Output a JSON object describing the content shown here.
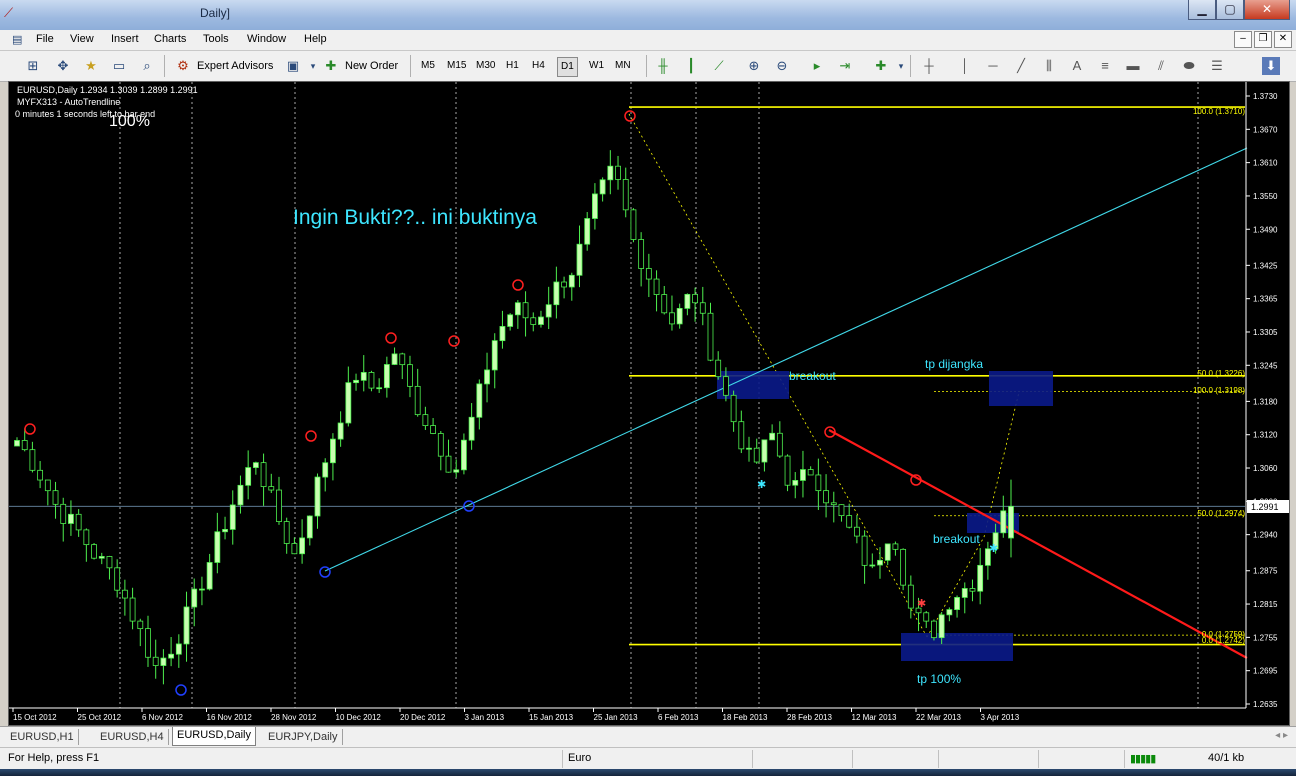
{
  "window": {
    "title": "Daily]",
    "app_icon": "chart-icon"
  },
  "menu": [
    "File",
    "View",
    "Insert",
    "Charts",
    "Tools",
    "Window",
    "Help"
  ],
  "toolbar": {
    "expert_advisors": "Expert Advisors",
    "new_order": "New Order",
    "timeframes": [
      "M5",
      "M15",
      "M30",
      "H1",
      "H4",
      "D1",
      "W1",
      "MN"
    ],
    "active_timeframe": "D1",
    "text_tool": "A"
  },
  "chart": {
    "info_line1": "EURUSD,Daily  1.2934 1.3039 1.2899 1.2991",
    "info_line2": "MYFX313 - AutoTrendline",
    "info_line3": "0 minutes 1 seconds left to bar end",
    "zoom_text": "100%",
    "headline": "Ingin Bukti??.. ini buktinya",
    "current_price": "1.2991",
    "annotations": {
      "breakout_top": "breakout",
      "tp_dijangka": "tp dijangka",
      "breakout_bottom": "breakout",
      "tp100": "tp 100%"
    },
    "fib_labels": {
      "f100_top": "100.0 (1.3710)",
      "f50_top": "50.0 (1.3226)",
      "f100_mid": "100.0 (1.3198)",
      "f50_mid": "50.0 (1.2974)",
      "f0_a": "0.0 (1.2759)",
      "f0_b": "0.0 (1.2742)"
    },
    "colors": {
      "bull": "#c8ffb0",
      "bear": "#000000",
      "wick": "#4ef04e",
      "fib": "#ffff00",
      "trend_cyan": "#40d8e8",
      "trend_red": "#ff1a1a",
      "zone": "#0a1a8a",
      "text_cyan": "#3ee6ff"
    }
  },
  "chart_data": {
    "type": "candlestick",
    "symbol": "EURUSD",
    "timeframe": "Daily",
    "y_ticks": [
      "1.3730",
      "1.3670",
      "1.3610",
      "1.3550",
      "1.3490",
      "1.3425",
      "1.3365",
      "1.3305",
      "1.3245",
      "1.3180",
      "1.3120",
      "1.3060",
      "1.3000",
      "1.2940",
      "1.2875",
      "1.2815",
      "1.2755",
      "1.2695",
      "1.2635"
    ],
    "x_ticks": [
      "15 Oct 2012",
      "25 Oct 2012",
      "6 Nov 2012",
      "16 Nov 2012",
      "28 Nov 2012",
      "10 Dec 2012",
      "20 Dec 2012",
      "3 Jan 2013",
      "15 Jan 2013",
      "25 Jan 2013",
      "6 Feb 2013",
      "18 Feb 2013",
      "28 Feb 2013",
      "12 Mar 2013",
      "22 Mar 2013",
      "3 Apr 2013"
    ],
    "ylim": [
      1.2635,
      1.373
    ],
    "close_anchors": [
      1.311,
      1.306,
      1.299,
      1.295,
      1.29,
      1.286,
      1.278,
      1.27,
      1.275,
      1.283,
      1.292,
      1.301,
      1.308,
      1.298,
      1.29,
      1.302,
      1.313,
      1.323,
      1.32,
      1.327,
      1.318,
      1.312,
      1.305,
      1.316,
      1.329,
      1.335,
      1.332,
      1.338,
      1.342,
      1.353,
      1.36,
      1.347,
      1.339,
      1.332,
      1.338,
      1.326,
      1.315,
      1.306,
      1.312,
      1.302,
      1.306,
      1.299,
      1.294,
      1.287,
      1.296,
      1.28,
      1.276,
      1.283,
      1.285,
      1.294,
      1.2991
    ],
    "last_ohlc": {
      "open": 1.2934,
      "high": 1.3039,
      "low": 1.2899,
      "close": 1.2991
    }
  },
  "tabs": [
    "EURUSD,H1",
    "EURUSD,H4",
    "EURUSD,Daily",
    "EURJPY,Daily"
  ],
  "active_tab": "EURUSD,Daily",
  "status": {
    "help": "For Help, press F1",
    "profile": "Euro",
    "traffic": "40/1 kb"
  }
}
